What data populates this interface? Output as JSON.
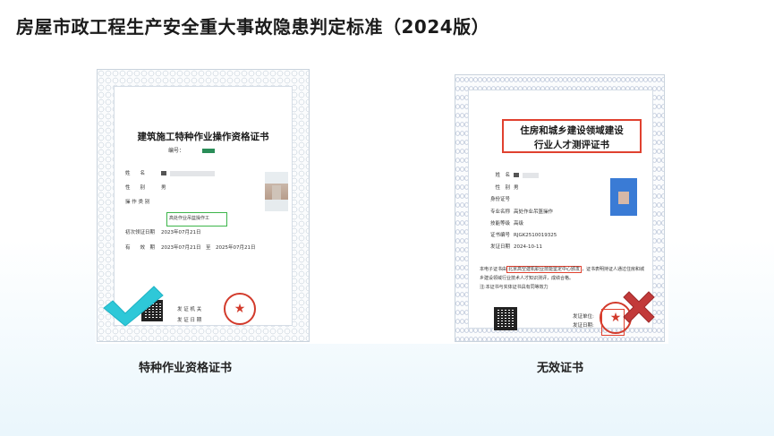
{
  "title": "房屋市政工程生产安全重大事故隐患判定标准（2024版）",
  "left_cert": {
    "title": "建筑施工特种作业操作资格证书",
    "number_label": "编号：",
    "fields": [
      {
        "label": "姓　　名",
        "value": ""
      },
      {
        "label": "性　　别",
        "value": "男"
      },
      {
        "label": "操 作 类 别",
        "value": "高处作业吊篮操作工"
      },
      {
        "label": "初次领证日期",
        "value": "2023年07月21日"
      },
      {
        "label": "有　　效　期",
        "value": "2023年07月21日　至　2025年07月21日"
      },
      {
        "label": "发 证 机 关",
        "value": ""
      },
      {
        "label": "发 证 日 期",
        "value": ""
      }
    ],
    "caption": "特种作业资格证书"
  },
  "right_cert": {
    "title_line1": "住房和城乡建设领域建设",
    "title_line2": "行业人才测评证书",
    "fields": [
      {
        "label": "姓　名",
        "value": ""
      },
      {
        "label": "性　别",
        "value": "男"
      },
      {
        "label": "身份证号",
        "value": ""
      },
      {
        "label": "专业名称",
        "value": "高处作业吊篮操作"
      },
      {
        "label": "技能等级",
        "value": "高级"
      },
      {
        "label": "证书编号",
        "value": "RJGK2510019325"
      },
      {
        "label": "发证日期",
        "value": "2024-10-11"
      }
    ],
    "body_prefix": "本电子证书由",
    "body_highlight": "北京高空建机职业技能鉴定中心颁发",
    "body_suffix": "，证书表明持证人通过住房和城乡建设领域行业技术人才知识测评，成绩合格。",
    "note": "注:本证书与实体证书具有同等效力",
    "issuer_label": "发证单位:",
    "date_label": "发证日期:",
    "caption": "无效证书"
  },
  "colors": {
    "valid": "#2ec8d8",
    "invalid": "#c23a3a",
    "highlight_green": "#3cb54a",
    "highlight_red": "#e0412f"
  },
  "icons": {
    "valid": "checkmark-icon",
    "invalid": "cross-icon"
  }
}
